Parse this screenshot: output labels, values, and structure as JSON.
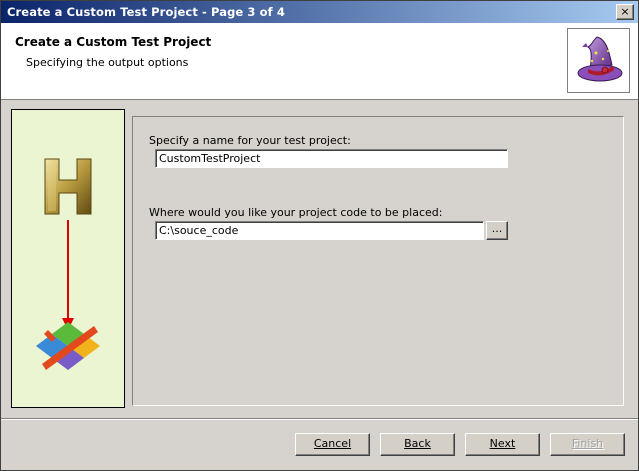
{
  "window": {
    "title": "Create a Custom Test Project - Page 3 of 4",
    "close_label": "×"
  },
  "header": {
    "title": "Create a Custom Test Project",
    "subtitle": "Specifying the output options",
    "image_icon": "wizard-hat-icon"
  },
  "side_panel": {
    "top_icon": "h-block-icon",
    "arrow_icon": "red-arrow-down-icon",
    "bottom_icon": "colorful-diamond-icon",
    "background_color": "#ebf5d1",
    "arrow_color": "#e00000"
  },
  "form": {
    "name_label": "Specify a name for your test project:",
    "name_value": "CustomTestProject",
    "location_label": "Where would you like your project code to be placed:",
    "location_value": "C:\\souce_code",
    "browse_label": "..."
  },
  "buttons": {
    "cancel": "Cancel",
    "back": "Back",
    "next": "Next",
    "finish": "Finish"
  },
  "colors": {
    "title_gradient_start": "#0a246a",
    "title_gradient_end": "#a6caf0",
    "dialog_background": "#d6d3ce"
  }
}
